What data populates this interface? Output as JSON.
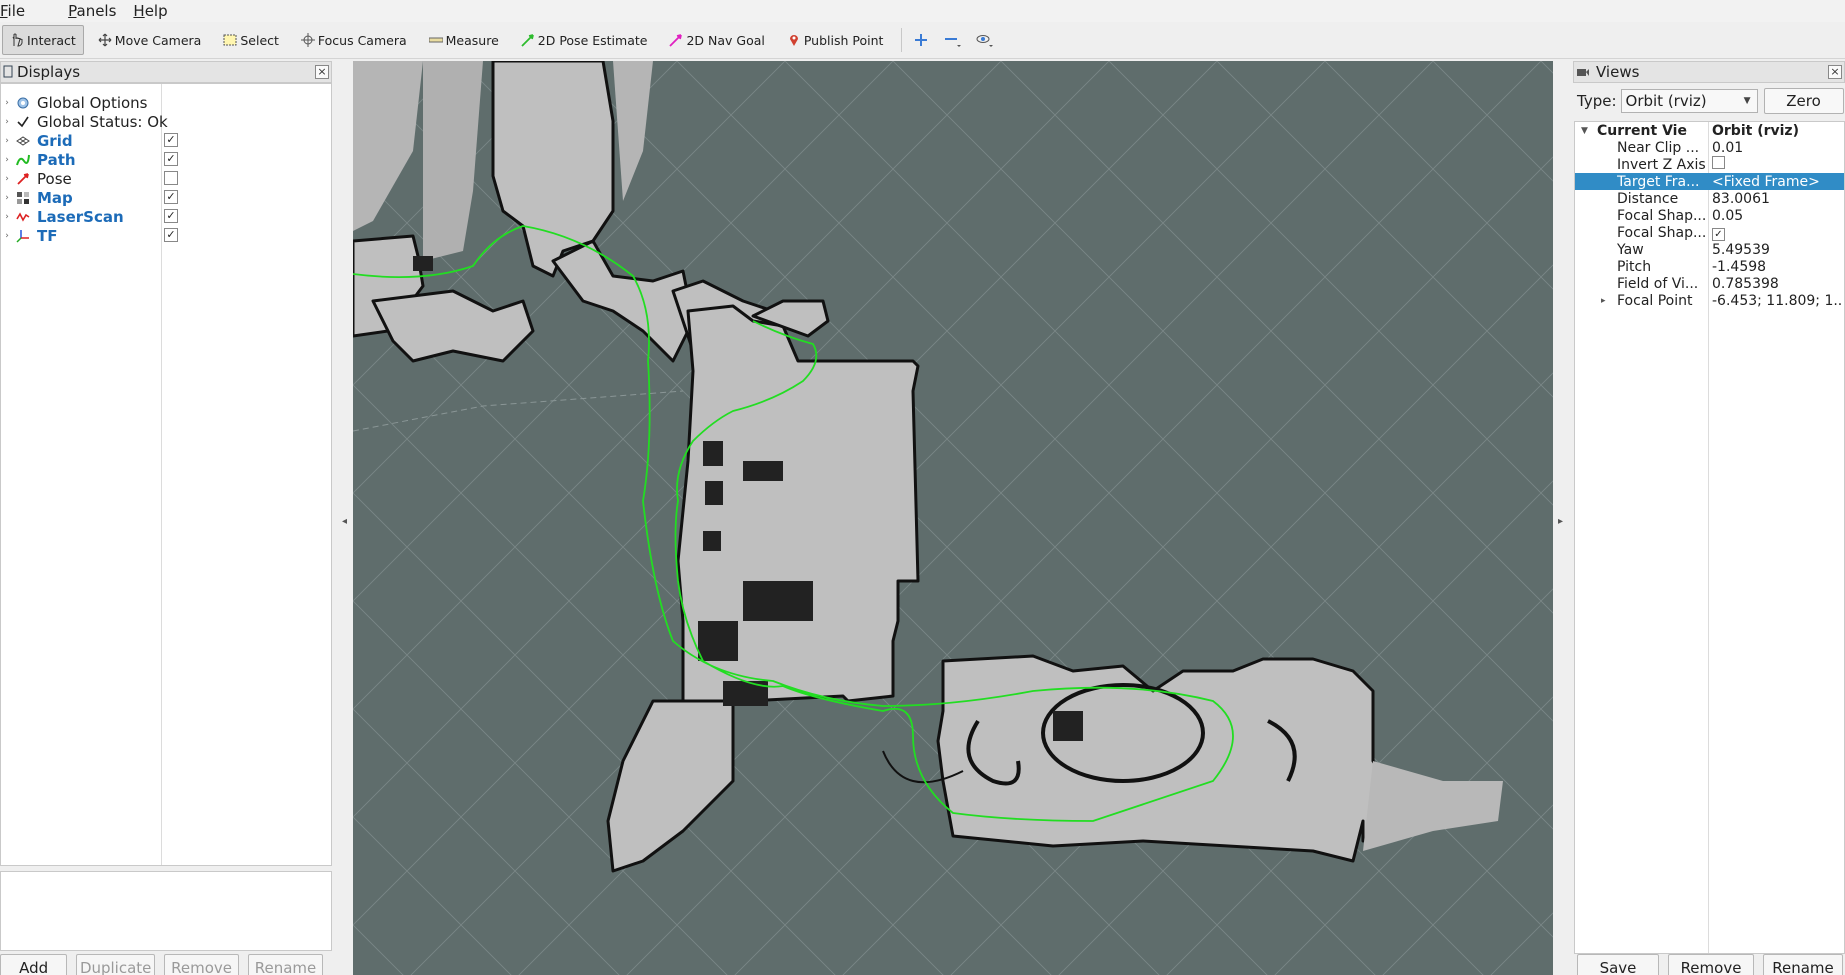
{
  "menu": [
    "File",
    "Panels",
    "Help"
  ],
  "toolbar": {
    "tools": [
      {
        "label": "Interact",
        "icon": "hand-pointer-icon",
        "active": true
      },
      {
        "label": "Move Camera",
        "icon": "move-arrows-icon",
        "active": false
      },
      {
        "label": "Select",
        "icon": "selection-box-icon",
        "active": false
      },
      {
        "label": "Focus Camera",
        "icon": "crosshair-icon",
        "active": false
      },
      {
        "label": "Measure",
        "icon": "ruler-icon",
        "active": false
      },
      {
        "label": "2D Pose Estimate",
        "icon": "green-arrow-icon",
        "active": false
      },
      {
        "label": "2D Nav Goal",
        "icon": "magenta-arrow-icon",
        "active": false
      },
      {
        "label": "Publish Point",
        "icon": "map-pin-icon",
        "active": false
      }
    ]
  },
  "displays": {
    "title": "Displays",
    "items": [
      {
        "label": "Global Options",
        "icon": "gear-icon",
        "blue": false,
        "checkbox": null
      },
      {
        "label": "Global Status: Ok",
        "icon": "checkmark-icon",
        "blue": false,
        "checkbox": null
      },
      {
        "label": "Grid",
        "icon": "grid-icon",
        "blue": true,
        "checkbox": true
      },
      {
        "label": "Path",
        "icon": "path-icon",
        "blue": true,
        "checkbox": true
      },
      {
        "label": "Pose",
        "icon": "pose-arrow-icon",
        "blue": false,
        "checkbox": false
      },
      {
        "label": "Map",
        "icon": "map-icon",
        "blue": true,
        "checkbox": true
      },
      {
        "label": "LaserScan",
        "icon": "laserscan-icon",
        "blue": true,
        "checkbox": true
      },
      {
        "label": "TF",
        "icon": "tf-axes-icon",
        "blue": true,
        "checkbox": true
      }
    ],
    "buttons": {
      "add": "Add",
      "duplicate": "Duplicate",
      "remove": "Remove",
      "rename": "Rename"
    }
  },
  "views": {
    "title": "Views",
    "type_label": "Type:",
    "type_value": "Orbit (rviz)",
    "zero": "Zero",
    "current_view": {
      "key": "Current View",
      "value": "Orbit (rviz)"
    },
    "props": [
      {
        "key": "Near Clip ...",
        "value": "0.01"
      },
      {
        "key": "Invert Z Axis",
        "value": ""
      },
      {
        "key": "Target Fra...",
        "value": "<Fixed Frame>"
      },
      {
        "key": "Distance",
        "value": "83.0061"
      },
      {
        "key": "Focal Shap...",
        "value": "0.05"
      },
      {
        "key": "Focal Shap...",
        "value": ""
      },
      {
        "key": "Yaw",
        "value": "5.49539"
      },
      {
        "key": "Pitch",
        "value": "-1.4598"
      },
      {
        "key": "Field of Vi...",
        "value": "0.785398"
      },
      {
        "key": "Focal Point",
        "value": "-6.453; 11.809; 1..."
      }
    ],
    "buttons": {
      "save": "Save",
      "remove": "Remove",
      "rename": "Rename"
    }
  },
  "colors": {
    "viewport_bg": "#5f6d6c",
    "map_free": "#bfbfbf",
    "path": "#22dd22",
    "selection": "#308cc6",
    "link_blue": "#1c6bb8"
  }
}
